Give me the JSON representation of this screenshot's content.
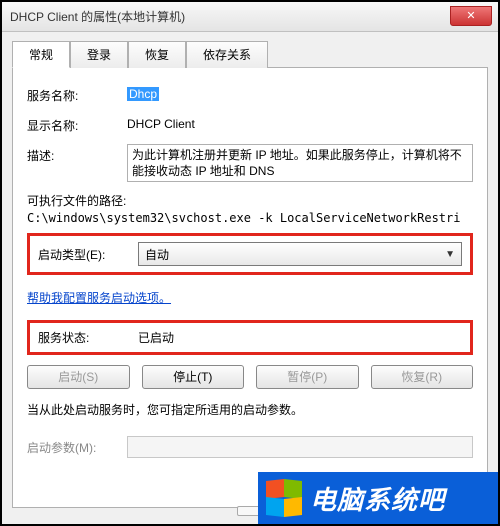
{
  "window": {
    "title": "DHCP Client 的属性(本地计算机)",
    "close": "✕"
  },
  "tabs": {
    "general": "常规",
    "logon": "登录",
    "recovery": "恢复",
    "dependencies": "依存关系"
  },
  "fields": {
    "service_name_label": "服务名称:",
    "service_name": "Dhcp",
    "display_name_label": "显示名称:",
    "display_name": "DHCP Client",
    "description_label": "描述:",
    "description": "为此计算机注册并更新 IP 地址。如果此服务停止，计算机将不能接收动态 IP 地址和 DNS",
    "exe_path_label": "可执行文件的路径:",
    "exe_path": "C:\\windows\\system32\\svchost.exe -k LocalServiceNetworkRestri",
    "startup_type_label": "启动类型(E):",
    "startup_type": "自动",
    "help_link": "帮助我配置服务启动选项。",
    "status_label": "服务状态:",
    "status_value": "已启动",
    "hint": "当从此处启动服务时，您可指定所适用的启动参数。",
    "start_params_label": "启动参数(M):",
    "start_params": ""
  },
  "buttons": {
    "start": "启动(S)",
    "stop": "停止(T)",
    "pause": "暂停(P)",
    "resume": "恢复(R)"
  },
  "watermark": "电脑系统吧"
}
